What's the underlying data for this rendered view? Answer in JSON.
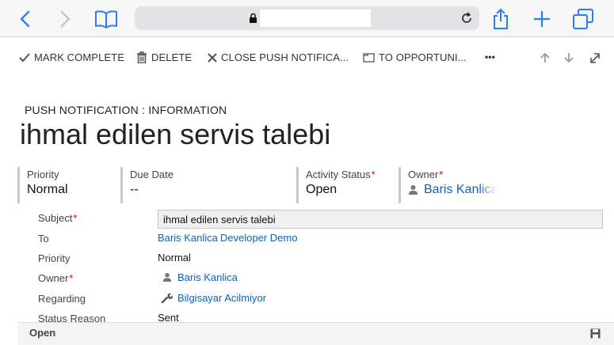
{
  "command_bar": {
    "mark_complete": "MARK COMPLETE",
    "delete": "DELETE",
    "close": "CLOSE PUSH NOTIFICA...",
    "convert": "TO OPPORTUNI...",
    "more": "•••"
  },
  "header": {
    "entity_label": "PUSH NOTIFICATION : INFORMATION",
    "title": "ihmal edilen servis talebi",
    "fields": [
      {
        "label": "Priority",
        "value": "Normal"
      },
      {
        "label": "Due Date",
        "value": "--"
      },
      {
        "label": "Activity Status",
        "value": "Open"
      },
      {
        "label": "Owner",
        "value": "Baris Kanlica"
      }
    ]
  },
  "form": {
    "subject": {
      "label": "Subject",
      "value": "ihmal edilen servis talebi"
    },
    "to": {
      "label": "To",
      "values": [
        "Baris Kanlica",
        "Developer Demo"
      ]
    },
    "priority": {
      "label": "Priority",
      "value": "Normal"
    },
    "owner": {
      "label": "Owner",
      "value": "Baris Kanlica"
    },
    "regarding": {
      "label": "Regarding",
      "value": "Bilgisayar Acilmiyor"
    },
    "status_reason": {
      "label": "Status Reason",
      "value": "Sent"
    }
  },
  "footer": {
    "status": "Open"
  },
  "required_marker": "*",
  "colors": {
    "link": "#1160b7",
    "required": "#e00000",
    "safari_blue": "#2f7cf6"
  }
}
